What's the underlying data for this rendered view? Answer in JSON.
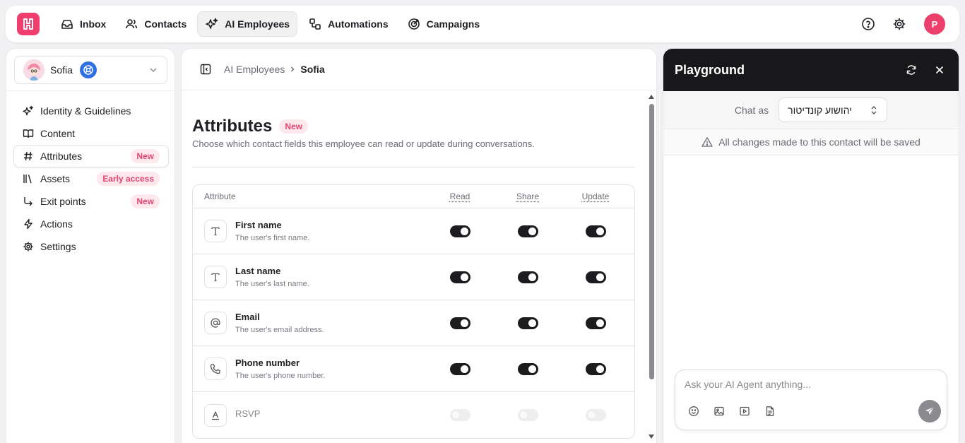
{
  "nav": {
    "items": [
      {
        "label": "Inbox",
        "icon": "inbox-icon"
      },
      {
        "label": "Contacts",
        "icon": "contacts-icon"
      },
      {
        "label": "AI Employees",
        "icon": "sparkle-icon",
        "active": true
      },
      {
        "label": "Automations",
        "icon": "automations-icon"
      },
      {
        "label": "Campaigns",
        "icon": "target-icon"
      }
    ],
    "user_initial": "P"
  },
  "sidebar": {
    "employee_name": "Sofia",
    "items": [
      {
        "label": "Identity & Guidelines",
        "icon": "sparkle-icon",
        "badge": ""
      },
      {
        "label": "Content",
        "icon": "book-icon",
        "badge": ""
      },
      {
        "label": "Attributes",
        "icon": "hash-icon",
        "badge": "New",
        "active": true
      },
      {
        "label": "Assets",
        "icon": "library-icon",
        "badge": "Early access"
      },
      {
        "label": "Exit points",
        "icon": "corner-arrow-icon",
        "badge": "New"
      },
      {
        "label": "Actions",
        "icon": "bolt-icon",
        "badge": ""
      },
      {
        "label": "Settings",
        "icon": "gear-icon",
        "badge": ""
      }
    ]
  },
  "main": {
    "breadcrumb": {
      "parent": "AI Employees",
      "current": "Sofia"
    },
    "title": "Attributes",
    "title_badge": "New",
    "subtitle": "Choose which contact fields this employee can read or update during conversations.",
    "table": {
      "headers": {
        "attribute": "Attribute",
        "read": "Read",
        "share": "Share",
        "update": "Update"
      },
      "rows": [
        {
          "icon": "text-icon",
          "glyph": "T",
          "title": "First name",
          "desc": "The user's first name.",
          "read": true,
          "share": true,
          "update": true,
          "disabled": false
        },
        {
          "icon": "text-icon",
          "glyph": "T",
          "title": "Last name",
          "desc": "The user's last name.",
          "read": true,
          "share": true,
          "update": true,
          "disabled": false
        },
        {
          "icon": "at-icon",
          "glyph": "@",
          "title": "Email",
          "desc": "The user's email address.",
          "read": true,
          "share": true,
          "update": true,
          "disabled": false
        },
        {
          "icon": "phone-icon",
          "glyph": "",
          "title": "Phone number",
          "desc": "The user's phone number.",
          "read": true,
          "share": true,
          "update": true,
          "disabled": false
        },
        {
          "icon": "text-format-icon",
          "glyph": "A",
          "title": "RSVP",
          "desc": "",
          "read": false,
          "share": false,
          "update": false,
          "disabled": true
        }
      ]
    }
  },
  "playground": {
    "title": "Playground",
    "chat_as_label": "Chat as",
    "chat_as_value": "יהושוע קונדיטור",
    "notice": "All changes made to this contact will be saved",
    "input_placeholder": "Ask your AI Agent anything..."
  },
  "colors": {
    "brand": "#ef3d6e",
    "badge_bg": "#fde8ee",
    "badge_text": "#e4466f",
    "toggle_on": "#1c1c1e",
    "header_dark": "#18181a"
  }
}
